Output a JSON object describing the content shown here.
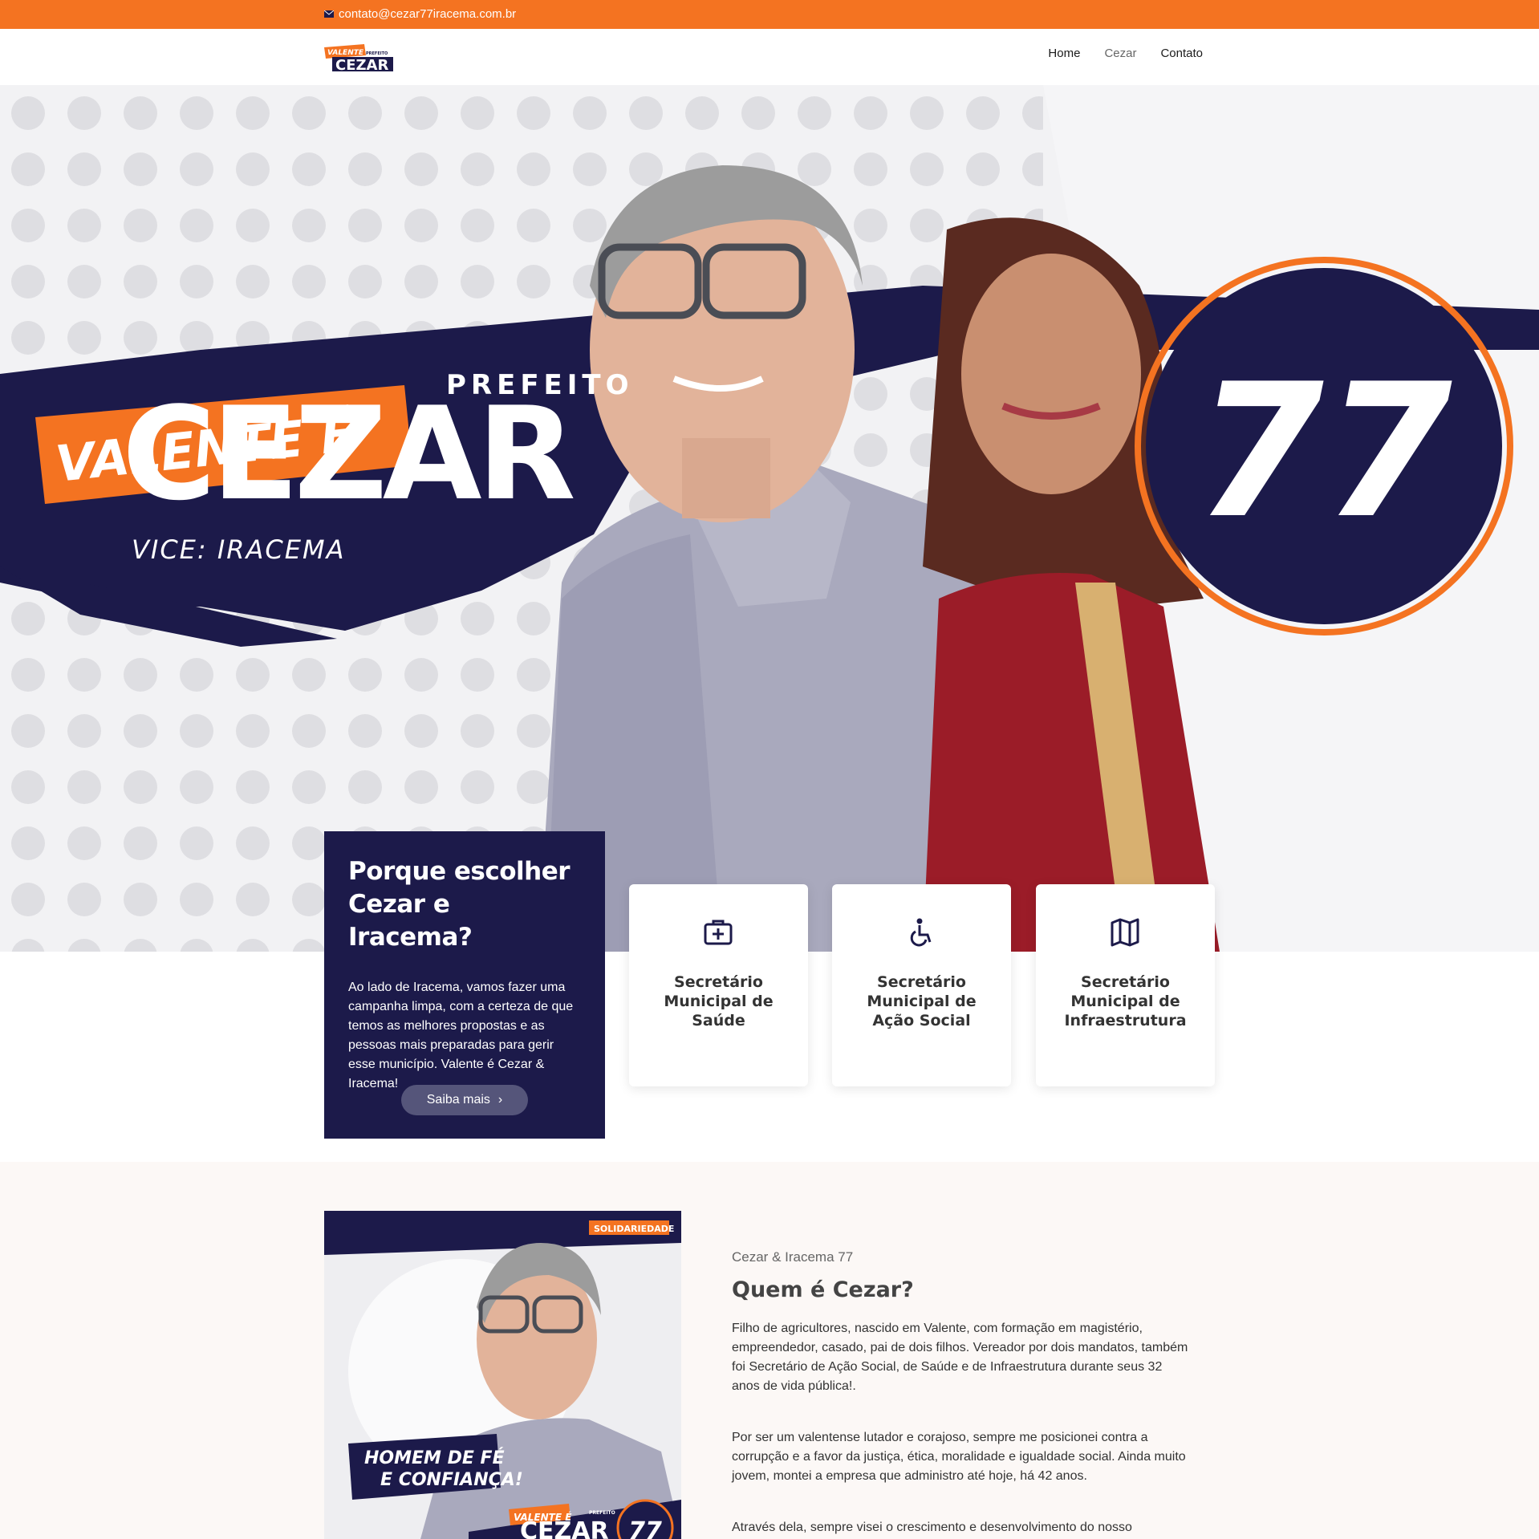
{
  "topbar": {
    "email": "contato@cezar77iracema.com.br",
    "icon": "envelope-icon"
  },
  "header": {
    "logo": {
      "line1": "VALENTE É",
      "line2": "CEZAR",
      "small": "PREFEITO"
    },
    "nav": [
      "Home",
      "Cezar",
      "Contato"
    ],
    "active_nav": "Cezar"
  },
  "hero": {
    "slogan": "VALENTE É",
    "office": "PREFEITO",
    "candidate": "CEZAR",
    "vice": "VICE: IRACEMA",
    "number": "77",
    "colors": {
      "orange": "#f47321",
      "navy": "#1c1a4a"
    }
  },
  "why": {
    "title": "Porque escolher Cezar e Iracema?",
    "text": "Ao lado de Iracema, vamos fazer uma campanha limpa, com a certeza de que temos as melhores propostas e as pessoas mais preparadas para gerir esse município. Valente é Cezar & Iracema!",
    "button": "Saiba mais",
    "button_icon": "chevron-right-icon"
  },
  "services": [
    {
      "title": "Secretário Municipal de Saúde",
      "icon": "medical-kit-icon"
    },
    {
      "title": "Secretário Municipal de Ação Social",
      "icon": "wheelchair-icon"
    },
    {
      "title": "Secretário Municipal de Infraestrutura",
      "icon": "map-icon"
    }
  ],
  "about": {
    "poster": {
      "party": "SOLIDARIEDADE",
      "tagline1": "HOMEM DE FÉ",
      "tagline2": "E CONFIANÇA!",
      "slogan": "VALENTE É",
      "office": "PREFEITO",
      "name": "CEZAR",
      "number": "77"
    },
    "subtitle": "Cezar & Iracema 77",
    "title": "Quem é Cezar?",
    "paragraphs": [
      "Filho de agricultores, nascido em Valente, com formação em magistério, empreendedor, casado, pai de dois filhos. Vereador por dois mandatos, também foi Secretário de Ação Social, de Saúde e de Infraestrutura durante seus 32 anos de vida pública!.",
      "Por ser um valentense lutador e corajoso, sempre me posicionei contra a corrupção e a favor da justiça, ética, moralidade e igualdade social. Ainda muito jovem, montei a empresa que administro até hoje, há 42 anos.",
      "Através dela, sempre visei o crescimento e desenvolvimento do nosso"
    ]
  }
}
